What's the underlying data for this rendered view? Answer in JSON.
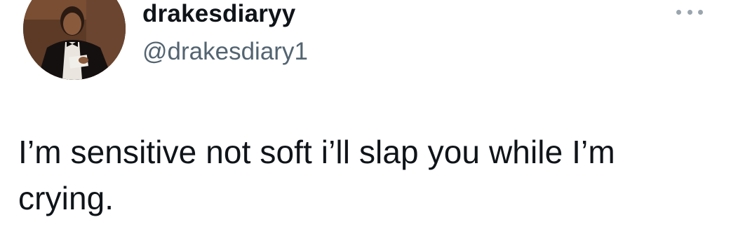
{
  "tweet": {
    "author": {
      "display_name": "drakesdiaryy",
      "handle": "@drakesdiary1",
      "avatar_icon": "user-avatar-photo"
    },
    "more_icon": "more-horizontal-icon",
    "text": "I’m sensitive not soft i’ll slap you while I’m crying."
  },
  "colors": {
    "text_primary": "#0f1419",
    "text_secondary": "#536471",
    "more_dots": "#9aa5ae",
    "background": "#ffffff"
  }
}
